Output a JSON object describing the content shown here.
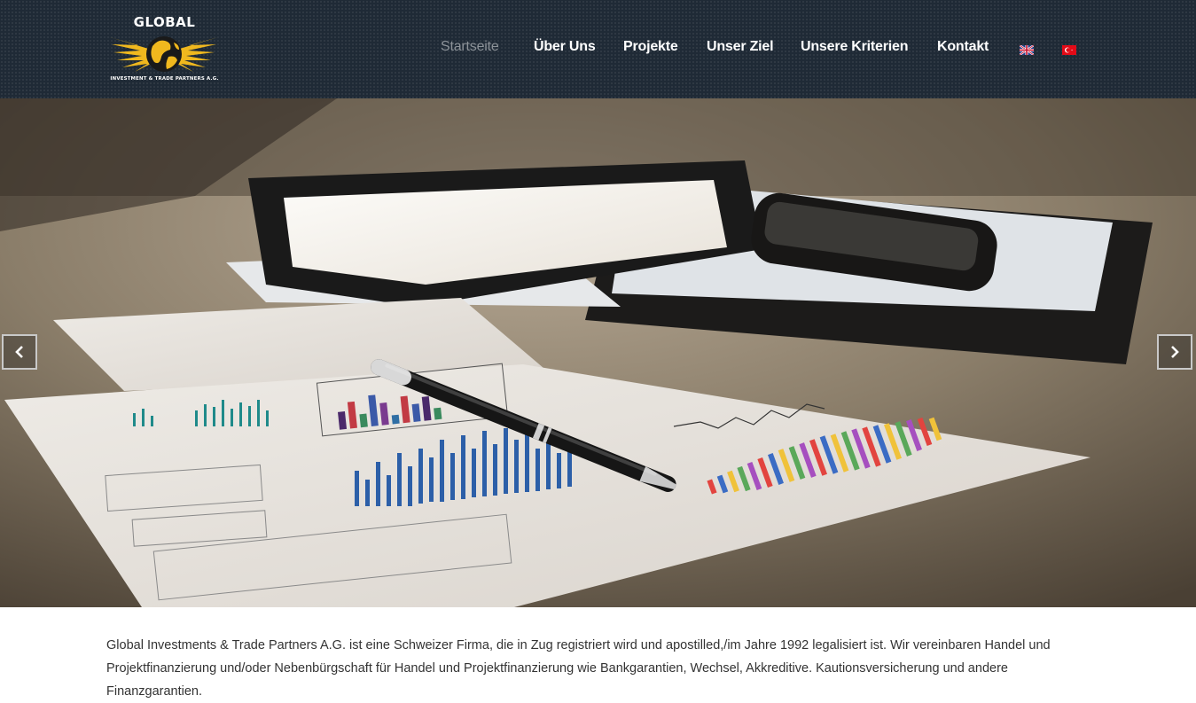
{
  "brand": {
    "title": "GLOBAL",
    "subtitle": "INVESTMENT & TRADE PARTNERS A.G."
  },
  "nav": {
    "items": [
      {
        "label": "Startseite",
        "active": true
      },
      {
        "label": "Über Uns"
      },
      {
        "label": "Projekte"
      },
      {
        "label": "Unser Ziel"
      },
      {
        "label": "Unsere Kriterien"
      },
      {
        "label": "Kontakt"
      }
    ],
    "languages": [
      "english-flag-icon",
      "turkish-flag-icon"
    ]
  },
  "slider": {
    "prev_icon": "chevron-left-icon",
    "next_icon": "chevron-right-icon"
  },
  "intro": {
    "text": "Global Investments & Trade Partners A.G. ist eine Schweizer Firma, die in Zug registriert wird und apostilled,/im Jahre 1992 legalisiert ist. Wir vereinbaren Handel und Projektfinanzierung und/oder Nebenbürgschaft für Handel und Projektfinanzierung wie Bankgarantien, Wechsel, Akkreditive. Kautionsversicherung und andere Finanzgarantien."
  },
  "colors": {
    "header_bg": "#1f2a36",
    "nav_active": "#8d9399",
    "logo_gold": "#f0b81e"
  }
}
